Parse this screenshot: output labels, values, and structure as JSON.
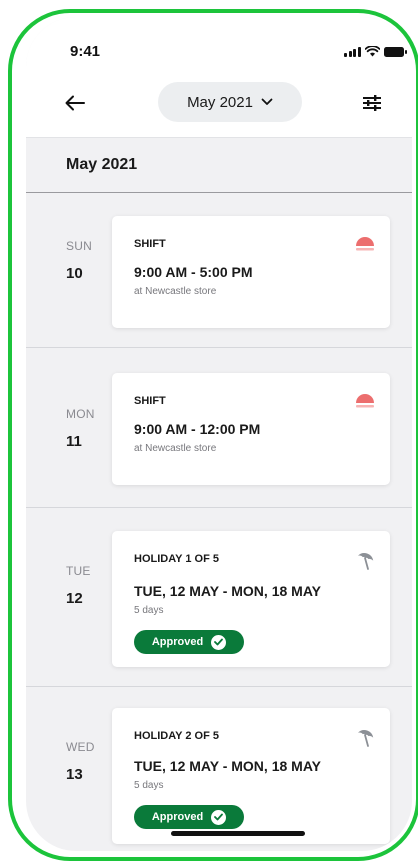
{
  "status_bar": {
    "time": "9:41"
  },
  "navbar": {
    "month_label": "May 2021"
  },
  "section": {
    "title": "May 2021"
  },
  "days": [
    {
      "dow": "SUN",
      "day": "10",
      "card": {
        "kind": "SHIFT",
        "time": "9:00 AM - 5:00 PM",
        "sub": "at Newcastle store",
        "icon": "sunset-icon"
      }
    },
    {
      "dow": "MON",
      "day": "11",
      "card": {
        "kind": "SHIFT",
        "time": "9:00 AM - 12:00 PM",
        "sub": "at Newcastle store",
        "icon": "sunset-icon"
      }
    },
    {
      "dow": "TUE",
      "day": "12",
      "card": {
        "kind": "HOLIDAY 1 OF 5",
        "time": "TUE, 12 MAY - MON, 18 MAY",
        "sub": "5 days",
        "icon": "umbrella-icon",
        "badge": "Approved"
      }
    },
    {
      "dow": "WED",
      "day": "13",
      "card": {
        "kind": "HOLIDAY 2 OF 5",
        "time": "TUE, 12 MAY - MON, 18 MAY",
        "sub": "5 days",
        "icon": "umbrella-icon",
        "badge": "Approved"
      }
    }
  ],
  "colors": {
    "frame": "#1cc43b",
    "shift_icon": "#ec6e6e",
    "holiday_icon": "#8c9096",
    "approved_badge": "#0a7a3a"
  }
}
